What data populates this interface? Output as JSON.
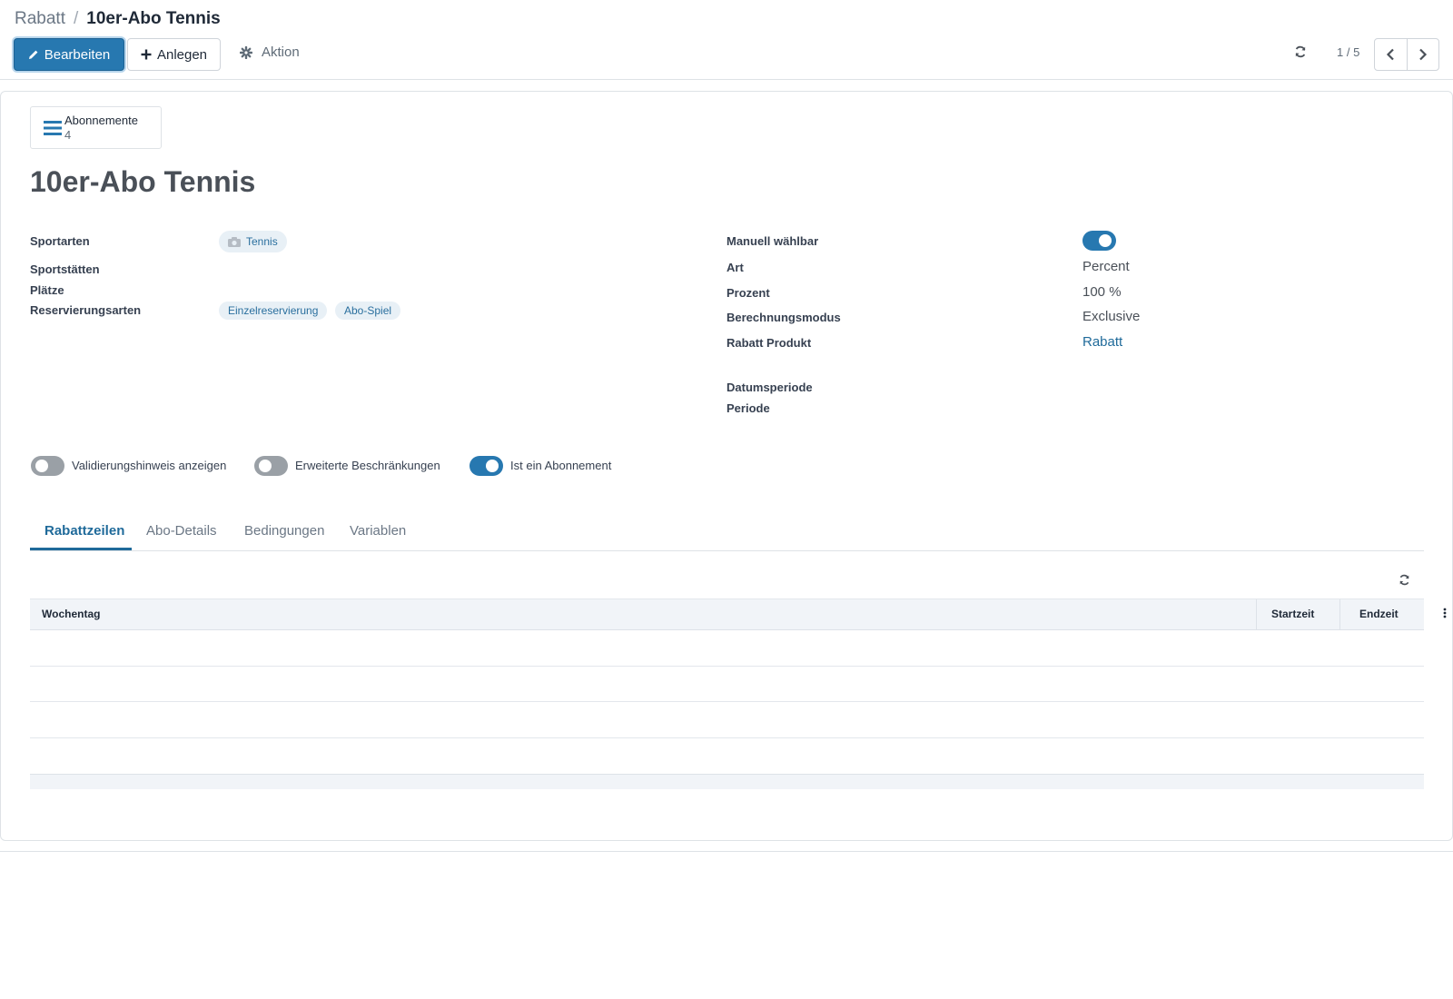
{
  "breadcrumb": {
    "parent": "Rabatt",
    "separator": "/",
    "current": "10er-Abo Tennis"
  },
  "toolbar": {
    "edit_label": "Bearbeiten",
    "create_label": "Anlegen",
    "action_label": "Aktion"
  },
  "pager": {
    "value": "1 / 5"
  },
  "smart_button": {
    "label": "Abonnemente",
    "count": "4"
  },
  "record": {
    "title": "10er-Abo Tennis"
  },
  "left_fields": {
    "sportarten_label": "Sportarten",
    "sportarten_tag": "Tennis",
    "sportstaetten_label": "Sportstätten",
    "plaetze_label": "Plätze",
    "reservierungsarten_label": "Reservierungsarten",
    "reservierungsarten_tags": [
      "Einzelreservierung",
      "Abo-Spiel"
    ]
  },
  "right_fields": {
    "manuell_label": "Manuell wählbar",
    "manuell_on": true,
    "art_label": "Art",
    "art_value": "Percent",
    "prozent_label": "Prozent",
    "prozent_value": "100 %",
    "modus_label": "Berechnungsmodus",
    "modus_value": "Exclusive",
    "produkt_label": "Rabatt Produkt",
    "produkt_value": "Rabatt",
    "datumsperiode_label": "Datumsperiode",
    "periode_label": "Periode"
  },
  "toggles": [
    {
      "label": "Validierungshinweis anzeigen",
      "on": false
    },
    {
      "label": "Erweiterte Beschränkungen",
      "on": false
    },
    {
      "label": "Ist ein Abonnement",
      "on": true
    }
  ],
  "tabs": [
    {
      "label": "Rabattzeilen",
      "active": true
    },
    {
      "label": "Abo-Details",
      "active": false
    },
    {
      "label": "Bedingungen",
      "active": false
    },
    {
      "label": "Variablen",
      "active": false
    }
  ],
  "table": {
    "columns": [
      "Wochentag",
      "Startzeit",
      "Endzeit"
    ]
  },
  "colors": {
    "primary": "#2778b0",
    "link": "#1f6a9a",
    "tag_bg": "#e8f0f6"
  },
  "icons": {
    "edit": "pencil-icon",
    "create": "plus-icon",
    "action": "gear-icon",
    "refresh": "refresh-icon",
    "prev": "chevron-left-icon",
    "next": "chevron-right-icon",
    "smart": "list-icon",
    "tag": "camera-icon",
    "optional": "vertical-dots-icon"
  }
}
